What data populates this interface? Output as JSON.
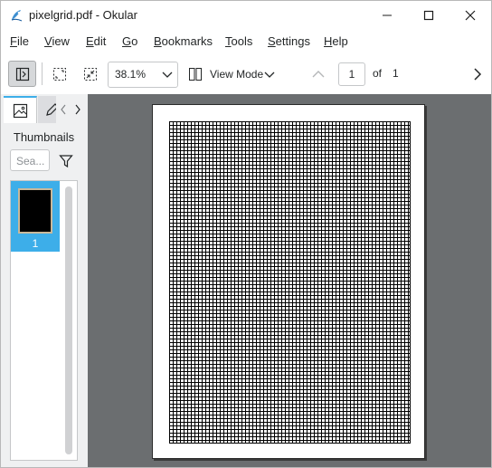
{
  "window": {
    "title": "pixelgrid.pdf  - Okular"
  },
  "menu": [
    {
      "label": "File",
      "ul": "F",
      "rest": "ile"
    },
    {
      "label": "View",
      "ul": "V",
      "rest": "iew"
    },
    {
      "label": "Edit",
      "ul": "E",
      "rest": "dit"
    },
    {
      "label": "Go",
      "ul": "G",
      "rest": "o"
    },
    {
      "label": "Bookmarks",
      "ul": "B",
      "rest": "ookmarks"
    },
    {
      "label": "Tools",
      "ul": "T",
      "rest": "ools"
    },
    {
      "label": "Settings",
      "ul": "S",
      "rest": "ettings"
    },
    {
      "label": "Help",
      "ul": "H",
      "rest": "elp"
    }
  ],
  "toolbar": {
    "zoom_value": "38.1%",
    "view_mode_label": "View Mode",
    "current_page": "1",
    "of_label": "of",
    "total_pages": "1"
  },
  "sidebar": {
    "title": "Thumbnails",
    "search_placeholder": "Sea...",
    "thumbnails": [
      {
        "label": "1"
      }
    ]
  },
  "colors": {
    "accent": "#3daee9",
    "document_background": "#6b6e70"
  },
  "icons": [
    "okular-app-icon",
    "minimize-icon",
    "maximize-icon",
    "close-icon",
    "sidebar-toggle-icon",
    "fit-to-page-icon",
    "zoom-fit-icon",
    "chevron-down-icon",
    "view-mode-icon",
    "previous-page-icon",
    "next-page-icon",
    "thumbnails-icon",
    "annotations-icon",
    "filter-icon"
  ]
}
